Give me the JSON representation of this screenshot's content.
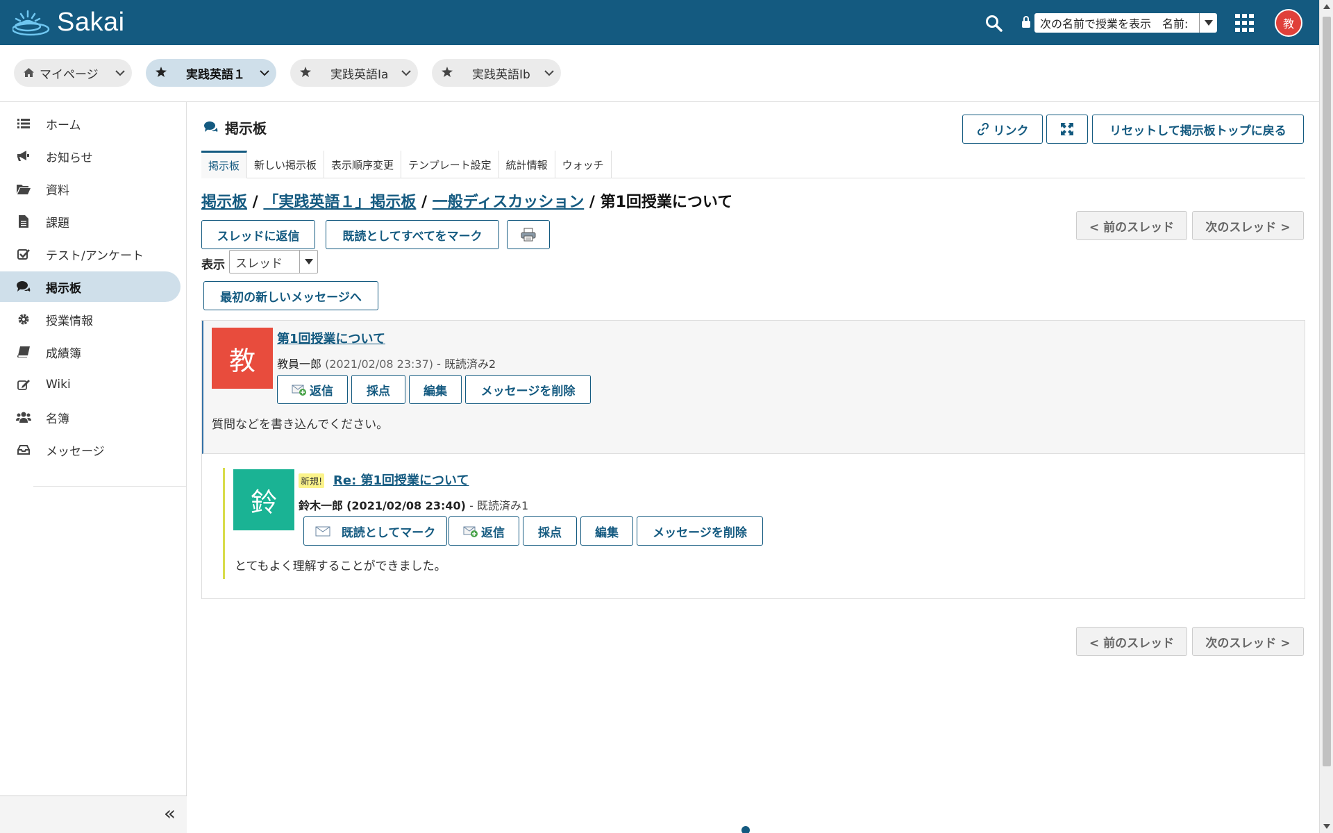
{
  "app": {
    "name": "Sakai"
  },
  "topbar": {
    "view_as_label": "次の名前で授業を表示　名前:",
    "user_avatar": "教"
  },
  "sites": [
    {
      "label": "マイページ",
      "icon": "home-icon"
    },
    {
      "label": "実践英語１",
      "icon": "star-icon",
      "active": true
    },
    {
      "label": "実践英語Ia",
      "icon": "star-icon"
    },
    {
      "label": "実践英語Ib",
      "icon": "star-icon"
    }
  ],
  "sidebar": {
    "items": [
      {
        "label": "ホーム",
        "icon": "list-icon"
      },
      {
        "label": "お知らせ",
        "icon": "megaphone-icon"
      },
      {
        "label": "資料",
        "icon": "folder-icon"
      },
      {
        "label": "課題",
        "icon": "file-icon"
      },
      {
        "label": "テスト/アンケート",
        "icon": "check-square-icon"
      },
      {
        "label": "掲示板",
        "icon": "comments-icon",
        "active": true
      },
      {
        "label": "授業情報",
        "icon": "gear-icon"
      },
      {
        "label": "成績簿",
        "icon": "book-icon"
      },
      {
        "label": "Wiki",
        "icon": "edit-icon"
      },
      {
        "label": "名簿",
        "icon": "users-icon"
      },
      {
        "label": "メッセージ",
        "icon": "inbox-icon"
      }
    ],
    "collapse_glyph": "«"
  },
  "tool": {
    "title": "掲示板",
    "link_label": "リンク",
    "reset_label": "リセットして掲示板トップに戻る",
    "tabs": [
      "掲示板",
      "新しい掲示板",
      "表示順序変更",
      "テンプレート設定",
      "統計情報",
      "ウォッチ"
    ]
  },
  "breadcrumb": {
    "items": [
      "掲示板",
      "「実践英語１」掲示板",
      "一般ディスカッション"
    ],
    "separator": " / ",
    "current": "第1回授業について"
  },
  "actions": {
    "reply_thread": "スレッドに返信",
    "mark_all_read": "既読としてすべてをマーク",
    "prev_thread": "< 前のスレッド",
    "next_thread": "次のスレッド >",
    "show_label": "表示",
    "show_value": "スレッド",
    "first_new": "最初の新しいメッセージへ"
  },
  "messages": [
    {
      "avatar": "教",
      "avatar_color": "#e84c3d",
      "title": "第1回授業について",
      "author": "教員一郎",
      "date": "(2021/02/08 23:37)",
      "read": "- 既読済み2",
      "buttons": {
        "reply": "返信",
        "grade": "採点",
        "edit": "編集",
        "delete": "メッセージを削除"
      },
      "body": "質問などを書き込んでください。"
    },
    {
      "avatar": "鈴",
      "avatar_color": "#1ab394",
      "new_badge": "新規!",
      "title": "Re: 第1回授業について",
      "author": "鈴木一郎",
      "date": "(2021/02/08 23:40)",
      "read": "- 既読済み1",
      "buttons": {
        "mark_read": "既読としてマーク",
        "reply": "返信",
        "grade": "採点",
        "edit": "編集",
        "delete": "メッセージを削除"
      },
      "body": "とてもよく理解することができました。"
    }
  ],
  "colors": {
    "brand": "#145a80",
    "active_bg": "#cfdfea"
  }
}
